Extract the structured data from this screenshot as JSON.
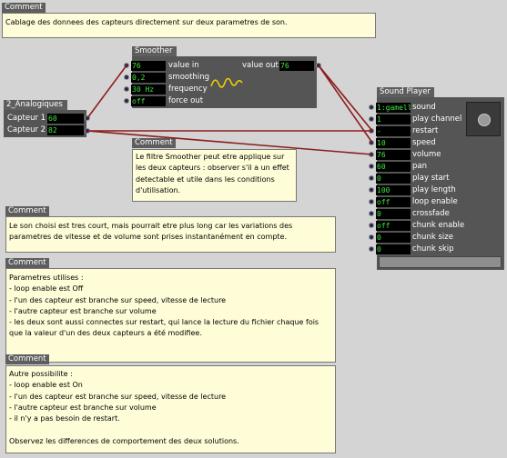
{
  "comments": {
    "c1": {
      "header": "Comment",
      "text": "Cablage des donnees des capteurs directement sur deux parametres de son."
    },
    "c2": {
      "header": "Comment",
      "text": "Le filtre Smoother peut etre applique sur les deux capteurs : observer s'il a un effet detectable et utile dans les conditions d'utilisation."
    },
    "c3": {
      "header": "Comment",
      "text": "Le son choisi est tres court, mais pourrait etre plus long car les variations des parametres de vitesse et de volume sont prises instantanément en compte."
    },
    "c4": {
      "header": "Comment",
      "text": "Parametres utilises :\n- loop enable est Off\n- l'un des capteur est branche sur speed, vitesse de lecture\n- l'autre capteur est branche sur volume\n- les deux sont aussi connectes sur restart, qui lance la lecture du fichier chaque fois que la valeur d'un des deux capteurs a été modifiee."
    },
    "c5": {
      "header": "Comment",
      "text": "Autre possibilite :\n- loop enable est On\n- l'un des capteur est branche sur speed, vitesse de lecture\n- l'autre capteur est branche sur volume\n- il n'y a pas besoin de restart.\n\nObservez les differences de comportement des deux solutions."
    }
  },
  "analog": {
    "title": "2_Analogiques",
    "rows": [
      {
        "label": "Capteur 1",
        "value": "60"
      },
      {
        "label": "Capteur 2",
        "value": "82"
      }
    ]
  },
  "smoother": {
    "title": "Smoother",
    "inputs": [
      {
        "value": "76",
        "label": "value in"
      },
      {
        "value": "0,2",
        "label": "smoothing"
      },
      {
        "value": "30 Hz",
        "label": "frequency"
      },
      {
        "value": "off",
        "label": "force out"
      }
    ],
    "output": {
      "label": "value out",
      "value": "76"
    }
  },
  "player": {
    "title": "Sound Player",
    "rows": [
      {
        "value": "1:gamelle",
        "label": "sound"
      },
      {
        "value": "1",
        "label": "play channel"
      },
      {
        "value": "-",
        "label": "restart"
      },
      {
        "value": "10",
        "label": "speed"
      },
      {
        "value": "76",
        "label": "volume"
      },
      {
        "value": "60",
        "label": "pan"
      },
      {
        "value": "0",
        "label": "play start"
      },
      {
        "value": "100",
        "label": "play length"
      },
      {
        "value": "off",
        "label": "loop enable"
      },
      {
        "value": "0",
        "label": "crossfade"
      },
      {
        "value": "off",
        "label": "chunk enable"
      },
      {
        "value": "0",
        "label": "chunk size"
      },
      {
        "value": "0",
        "label": "chunk skip"
      }
    ]
  },
  "colors": {
    "wire": "#8b1c1c",
    "wave": "#f0d000",
    "value_text": "#3ee83e",
    "comment_bg": "#fefdd8"
  }
}
